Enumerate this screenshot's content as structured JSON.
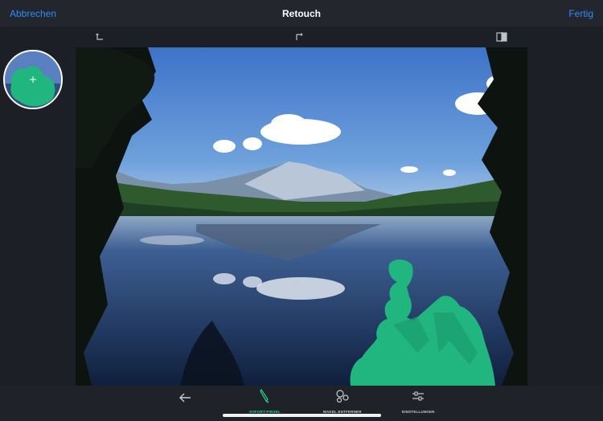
{
  "header": {
    "cancel_label": "Abbrechen",
    "title": "Retouch",
    "done_label": "Fertig"
  },
  "toolbar": {
    "icons": [
      "undo-icon",
      "redo-icon",
      "compare-icon"
    ]
  },
  "bottom_bar": {
    "back_icon": "back-arrow-icon",
    "tools": [
      {
        "label": "SOFORT-PINSEL",
        "icon": "brush-icon",
        "active": true
      },
      {
        "label": "MAKEL ENTFERNER",
        "icon": "blemish-remover-icon",
        "active": false
      },
      {
        "label": "EINSTELLUNGEN",
        "icon": "settings-sliders-icon",
        "active": false
      }
    ]
  },
  "colors": {
    "accent": "#2f8cf7",
    "active_tool": "#2bd48d",
    "mask": "#21b57f"
  }
}
